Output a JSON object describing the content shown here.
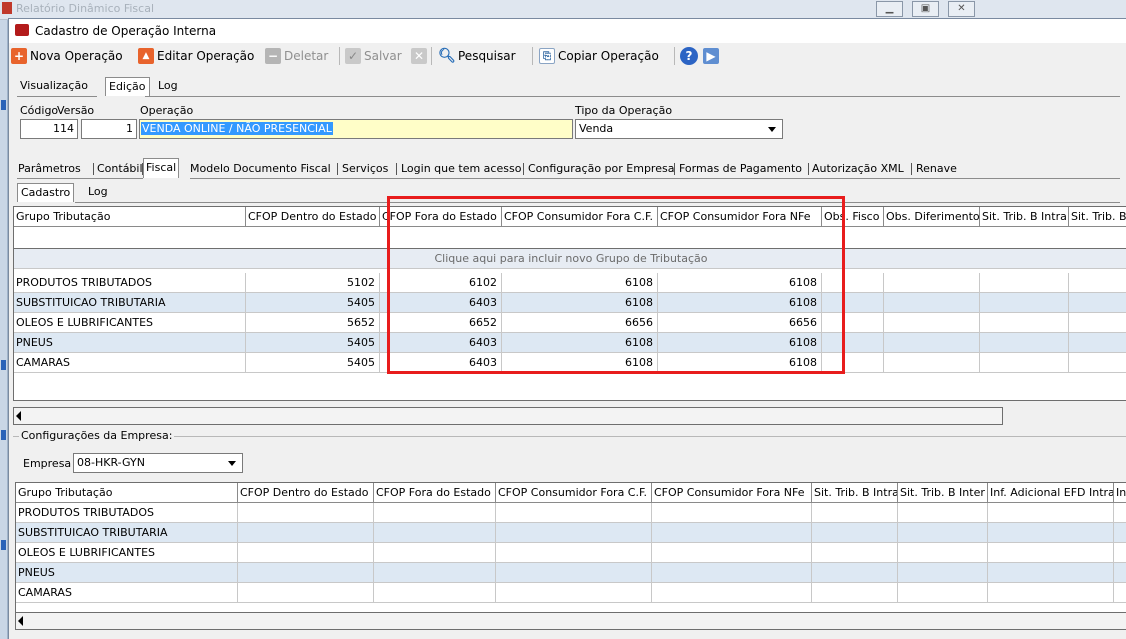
{
  "background_window": {
    "title": "Relatório Dinâmico Fiscal"
  },
  "window": {
    "title": "Cadastro de Operação Interna"
  },
  "toolbar": {
    "new_op": "Nova Operação",
    "edit_op": "Editar Operação",
    "delete": "Deletar",
    "save": "Salvar",
    "search": "Pesquisar",
    "copy_op": "Copiar Operação"
  },
  "view_tabs": [
    "Visualização",
    "Edição",
    "Log"
  ],
  "form": {
    "codigo_label": "Código",
    "versao_label": "Versão",
    "operacao_label": "Operação",
    "tipo_label": "Tipo da Operação",
    "codigo": "114",
    "versao": "1",
    "operacao": "VENDA ONLINE / NÃO PRESENCIAL",
    "tipo": "Venda"
  },
  "fiscal_tabs": [
    "Parâmetros",
    "Contábil",
    "Fiscal",
    "Modelo Documento Fiscal",
    "Serviços",
    "Login que tem acesso",
    "Configuração por Empresa",
    "Formas de Pagamento",
    "Autorização XML",
    "Renave"
  ],
  "sub_tabs": [
    "Cadastro",
    "Log"
  ],
  "grid1": {
    "headers": [
      "Grupo Tributação",
      "CFOP Dentro do Estado",
      "CFOP Fora do Estado",
      "CFOP Consumidor Fora C.F.",
      "CFOP Consumidor Fora NFe",
      "Obs. Fisco",
      "Obs. Diferimento",
      "Sit. Trib. B Intra",
      "Sit. Trib. B"
    ],
    "new_row_hint": "Clique aqui para incluir novo Grupo de Tributação",
    "rows": [
      [
        "PRODUTOS TRIBUTADOS",
        "5102",
        "6102",
        "6108",
        "6108"
      ],
      [
        "SUBSTITUICAO TRIBUTARIA",
        "5405",
        "6403",
        "6108",
        "6108"
      ],
      [
        "OLEOS E LUBRIFICANTES",
        "5652",
        "6652",
        "6656",
        "6656"
      ],
      [
        "PNEUS",
        "5405",
        "6403",
        "6108",
        "6108"
      ],
      [
        "CAMARAS",
        "5405",
        "6403",
        "6108",
        "6108"
      ]
    ]
  },
  "empresa": {
    "group_label": "Configurações da Empresa:",
    "label": "Empresa",
    "value": "08-HKR-GYN"
  },
  "grid2": {
    "headers": [
      "Grupo Tributação",
      "CFOP Dentro do Estado",
      "CFOP Fora do Estado",
      "CFOP Consumidor Fora C.F.",
      "CFOP Consumidor Fora NFe",
      "Sit. Trib. B Intra",
      "Sit. Trib. B Inter",
      "Inf. Adicional EFD Intra",
      "Inf"
    ],
    "rows": [
      "PRODUTOS TRIBUTADOS",
      "SUBSTITUICAO TRIBUTARIA",
      "OLEOS E LUBRIFICANTES",
      "PNEUS",
      "CAMARAS"
    ]
  },
  "colors": {
    "highlight_box": "#e81c1c",
    "selection": "#3399ff",
    "alt_row": "#dde8f3",
    "input_yellow": "#fffec8"
  }
}
